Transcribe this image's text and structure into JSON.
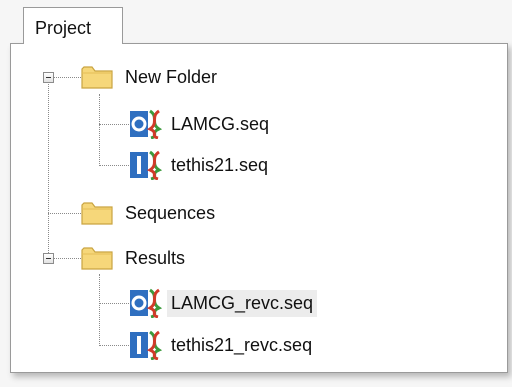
{
  "tab": {
    "label": "Project"
  },
  "tree": {
    "new_folder": {
      "label": "New Folder",
      "icon": "folder-icon"
    },
    "lamcg": {
      "label": "LAMCG.seq",
      "icon": "circular-sequence-icon"
    },
    "tethis21": {
      "label": "tethis21.seq",
      "icon": "linear-sequence-icon"
    },
    "sequences": {
      "label": "Sequences",
      "icon": "folder-icon"
    },
    "results": {
      "label": "Results",
      "icon": "folder-icon"
    },
    "lamcg_revc": {
      "label": "LAMCG_revc.seq",
      "icon": "circular-sequence-icon"
    },
    "tethis21_revc": {
      "label": "tethis21_revc.seq",
      "icon": "linear-sequence-icon"
    }
  },
  "colors": {
    "folder": "#f6d77a",
    "folder_border": "#c9a441",
    "seq_blue": "#2f6fc0",
    "helix_green": "#3c9a3c",
    "helix_red": "#d23a2a"
  }
}
